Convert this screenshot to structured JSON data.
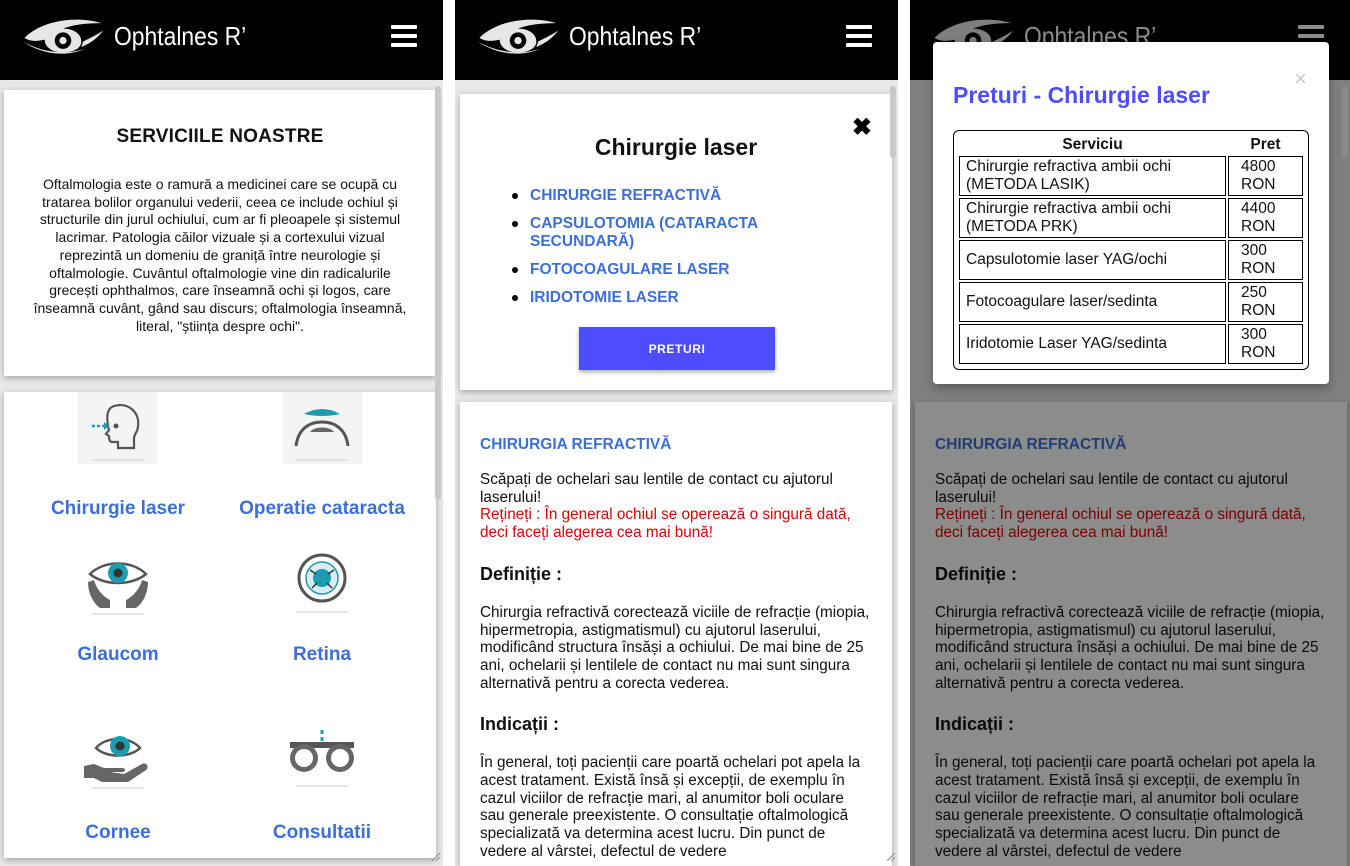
{
  "app": {
    "logo_text": "Ophtalnes R’"
  },
  "screen1": {
    "about_title": "SERVICIILE NOASTRE",
    "about_text": "Oftalmologia este o ramură a medicinei care se ocupă cu tratarea bolilor organului vederii, ceea ce include ochiul și structurile din jurul ochiului, cum ar fi pleoapele și sistemul lacrimar. Patologia căilor vizuale și a cortexului vizual reprezintă un domeniu de graniță între neurologie și oftalmologie. Cuvântul oftalmologie vine din radicalurile grecești ophthalmos, care înseamnă ochi și logos, care înseamnă cuvânt, gând sau discurs; oftalmologia înseamnă, literal, \"știința despre ochi\".",
    "services": [
      {
        "label": "Chirurgie laser",
        "icon": "head-laser-icon"
      },
      {
        "label": "Operatie cataracta",
        "icon": "cataract-eye-icon"
      },
      {
        "label": "Glaucom",
        "icon": "hands-eye-icon"
      },
      {
        "label": "Retina",
        "icon": "retina-icon"
      },
      {
        "label": "Cornee",
        "icon": "hand-eye-icon"
      },
      {
        "label": "Consultatii",
        "icon": "trial-frame-icon"
      }
    ]
  },
  "screen2": {
    "title": "Chirurgie laser",
    "close": "✖",
    "links": [
      "CHIRURGIE REFRACTIVĂ",
      "CAPSULOTOMIA (CATARACTA SECUNDARĂ)",
      "FOTOCOAGULARE LASER",
      "IRIDOTOMIE LASER"
    ],
    "button": "PRETURI",
    "section_title": "CHIRURGIA REFRACTIVĂ",
    "intro": "Scăpați de ochelari sau lentile de contact cu ajutorul laserului!",
    "warning": "Rețineți : În general ochiul se operează o singură dată, deci faceți alegerea cea mai bună!",
    "def_heading": "Definiție :",
    "def_text": "Chirurgia refractivă corectează viciile de refracție (miopia, hipermetropia, astigmatismul) cu ajutorul laserului, modificând structura însăși a ochiului. De mai bine de 25 ani, ochelarii și lentilele de contact nu mai sunt singura alternativă pentru a corecta vederea.",
    "ind_heading": "Indicații :",
    "ind_text": "În general, toți pacienții care poartă ochelari pot apela la acest tratament. Există însă și excepții, de exemplu în cazul viciilor de refracție mari, al anumitor boli oculare sau generale preexistente. O consultație oftalmologică specializată va determina acest lucru. Din punct de vedere al vârstei, defectul de vedere"
  },
  "screen3": {
    "modal_title": "Preturi - Chirurgie laser",
    "close": "×",
    "headers": [
      "Serviciu",
      "Pret"
    ],
    "rows": [
      {
        "service": "Chirurgie refractiva ambii ochi (METODA LASIK)",
        "price": "4800 RON"
      },
      {
        "service": "Chirurgie refractiva ambii ochi (METODA PRK)",
        "price": "4400 RON"
      },
      {
        "service": "Capsulotomie laser YAG/ochi",
        "price": "300 RON"
      },
      {
        "service": "Fotocoagulare laser/sedinta",
        "price": "250 RON"
      },
      {
        "service": "Iridotomie Laser YAG/sedinta",
        "price": "300 RON"
      }
    ]
  },
  "colors": {
    "link_blue": "#3d6fd8",
    "button_blue": "#4d4dff",
    "warning_red": "#e00000",
    "teal_icon": "#1a9db0"
  }
}
